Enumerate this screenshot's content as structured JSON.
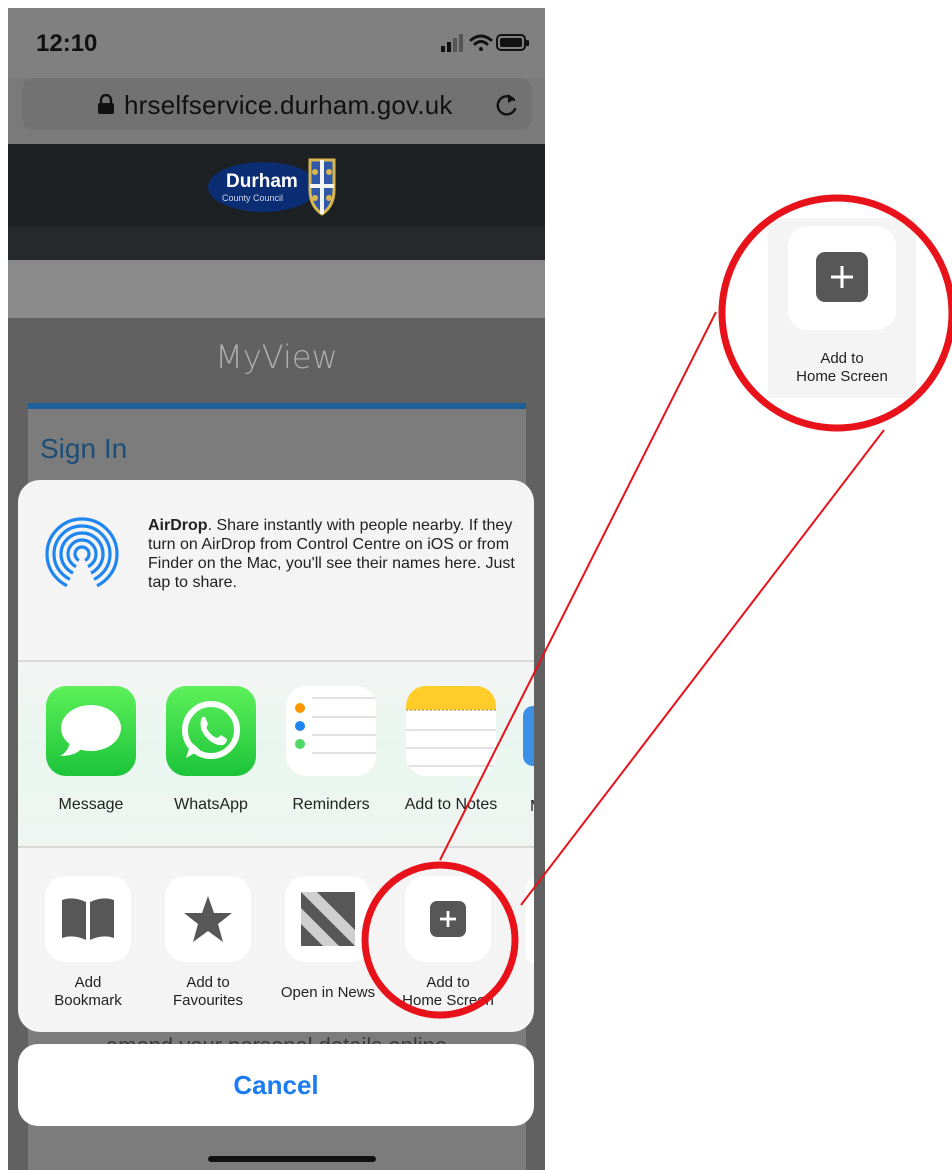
{
  "status_bar": {
    "time": "12:10"
  },
  "browser": {
    "url": "hrselfservice.durham.gov.uk"
  },
  "site": {
    "logo_name": "Durham",
    "logo_sub": "County Council",
    "page_title": "MyView",
    "signin_heading": "Sign In",
    "bottom_text": "amend your personal details online"
  },
  "share_sheet": {
    "airdrop": {
      "title": "AirDrop",
      "description": ". Share instantly with people nearby. If they turn on AirDrop from Control Centre on iOS or from Finder on the Mac, you'll see their names here. Just tap to share."
    },
    "apps": [
      {
        "label": "Message",
        "icon": "message-icon"
      },
      {
        "label": "WhatsApp",
        "icon": "whatsapp-icon"
      },
      {
        "label": "Reminders",
        "icon": "reminders-icon"
      },
      {
        "label": "Add to Notes",
        "icon": "notes-icon"
      }
    ],
    "partial_app_label": "M",
    "actions": [
      {
        "label_line1": "Add",
        "label_line2": "Bookmark",
        "icon": "book-icon"
      },
      {
        "label_line1": "Add to",
        "label_line2": "Favourites",
        "icon": "star-icon"
      },
      {
        "label_line1": "Open in News",
        "label_line2": "",
        "icon": "news-icon"
      },
      {
        "label_line1": "Add to",
        "label_line2": "Home Screen",
        "icon": "plus-square-icon"
      }
    ],
    "cancel_label": "Cancel"
  },
  "callout": {
    "label_line1": "Add to",
    "label_line2": "Home Screen",
    "highlight_color": "#e8121b"
  },
  "colors": {
    "ios_blue": "#1a7cf0",
    "header_dark": "#1d2123",
    "signin_accent": "#1c5f99"
  }
}
